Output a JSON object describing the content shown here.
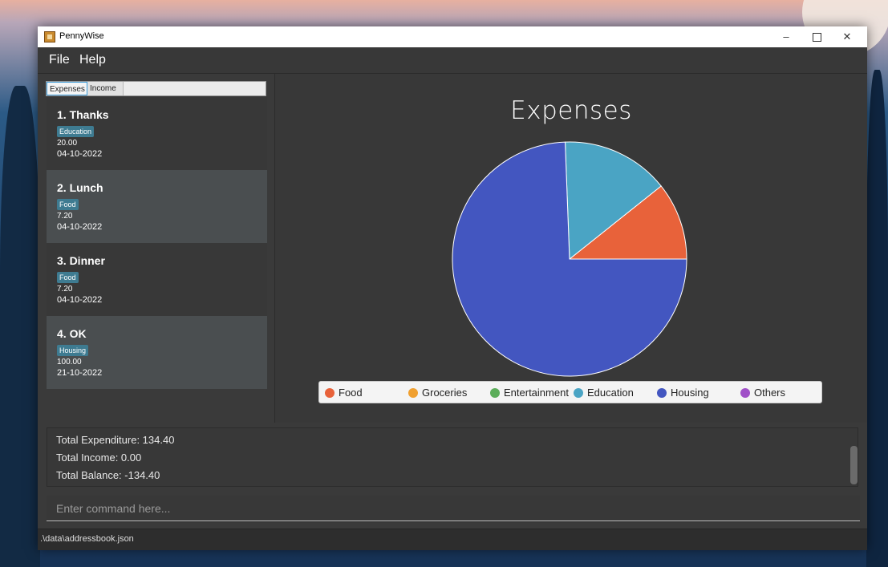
{
  "window": {
    "title": "PennyWise",
    "controls": {
      "minimize": "–",
      "close": "✕"
    }
  },
  "menu": [
    "File",
    "Help"
  ],
  "tabs": [
    {
      "label": "Expenses",
      "selected": true
    },
    {
      "label": "Income",
      "selected": false
    }
  ],
  "entries": [
    {
      "title": "1.  Thanks",
      "tag": "Education",
      "amount": "20.00",
      "date": "04-10-2022"
    },
    {
      "title": "2.  Lunch",
      "tag": "Food",
      "amount": "7.20",
      "date": "04-10-2022"
    },
    {
      "title": "3.  Dinner",
      "tag": "Food",
      "amount": "7.20",
      "date": "04-10-2022"
    },
    {
      "title": "4.  OK",
      "tag": "Housing",
      "amount": "100.00",
      "date": "21-10-2022"
    }
  ],
  "chart_data": {
    "type": "pie",
    "title": "Expenses",
    "slices": [
      {
        "label": "Food",
        "value": 14.4,
        "color": "#e8623a"
      },
      {
        "label": "Groceries",
        "value": 0,
        "color": "#f0a030"
      },
      {
        "label": "Entertainment",
        "value": 0,
        "color": "#5cad5a"
      },
      {
        "label": "Education",
        "value": 20.0,
        "color": "#4aa4c4"
      },
      {
        "label": "Housing",
        "value": 100.0,
        "color": "#4356c0"
      },
      {
        "label": "Others",
        "value": 0,
        "color": "#a050c8"
      }
    ],
    "legend_position": "bottom"
  },
  "summary": {
    "total_expenditure": "Total Expenditure: 134.40",
    "total_income": "Total Income: 0.00",
    "total_balance": "Total Balance: -134.40"
  },
  "command": {
    "placeholder": "Enter command here..."
  },
  "status": {
    "path": ".\\data\\addressbook.json"
  }
}
